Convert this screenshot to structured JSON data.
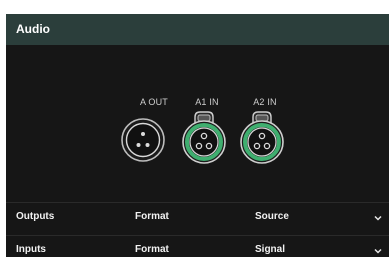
{
  "header": {
    "title": "Audio"
  },
  "ports": [
    {
      "label": "A OUT",
      "type": "xlr-male",
      "active": false
    },
    {
      "label": "A1 IN",
      "type": "xlr-female",
      "active": true
    },
    {
      "label": "A2 IN",
      "type": "xlr-female",
      "active": true
    }
  ],
  "sections": [
    {
      "name": "Outputs",
      "col2": "Format",
      "col3": "Source"
    },
    {
      "name": "Inputs",
      "col2": "Format",
      "col3": "Signal"
    }
  ],
  "colors": {
    "accent": "#3fae6f",
    "header_bg": "#2b3e3b",
    "panel_bg": "#161616"
  },
  "icons": {
    "expand": "chevron-down-icon"
  }
}
